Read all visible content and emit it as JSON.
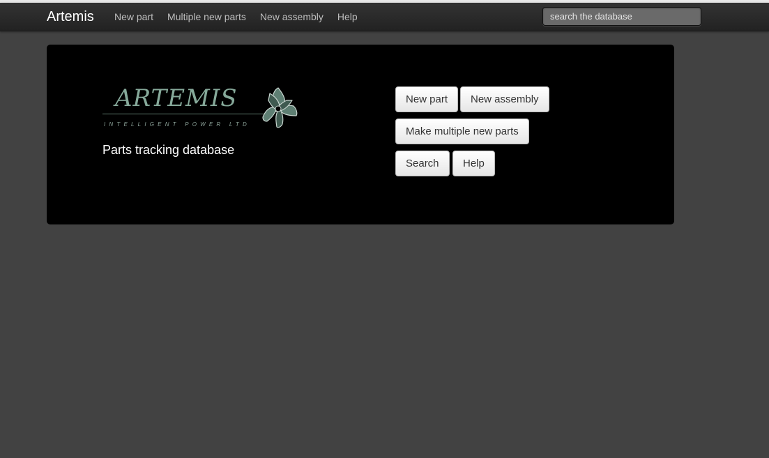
{
  "navbar": {
    "brand": "Artemis",
    "links": [
      "New part",
      "Multiple new parts",
      "New assembly",
      "Help"
    ],
    "search_placeholder": "search the database"
  },
  "hero": {
    "logo": {
      "wordmark": "ARTEMIS",
      "tagline": "INTELLIGENT POWER LTD",
      "emblem_icon": "artemis-emblem-icon"
    },
    "title": "Parts tracking database",
    "buttons": {
      "new_part": "New part",
      "new_assembly": "New assembly",
      "multiple_new_parts": "Make multiple new parts",
      "search": "Search",
      "help": "Help"
    }
  },
  "colors": {
    "page_background": "#424242",
    "navbar_background": "#2b2b2b",
    "hero_background": "#000000",
    "logo_green": "#86a99a"
  }
}
